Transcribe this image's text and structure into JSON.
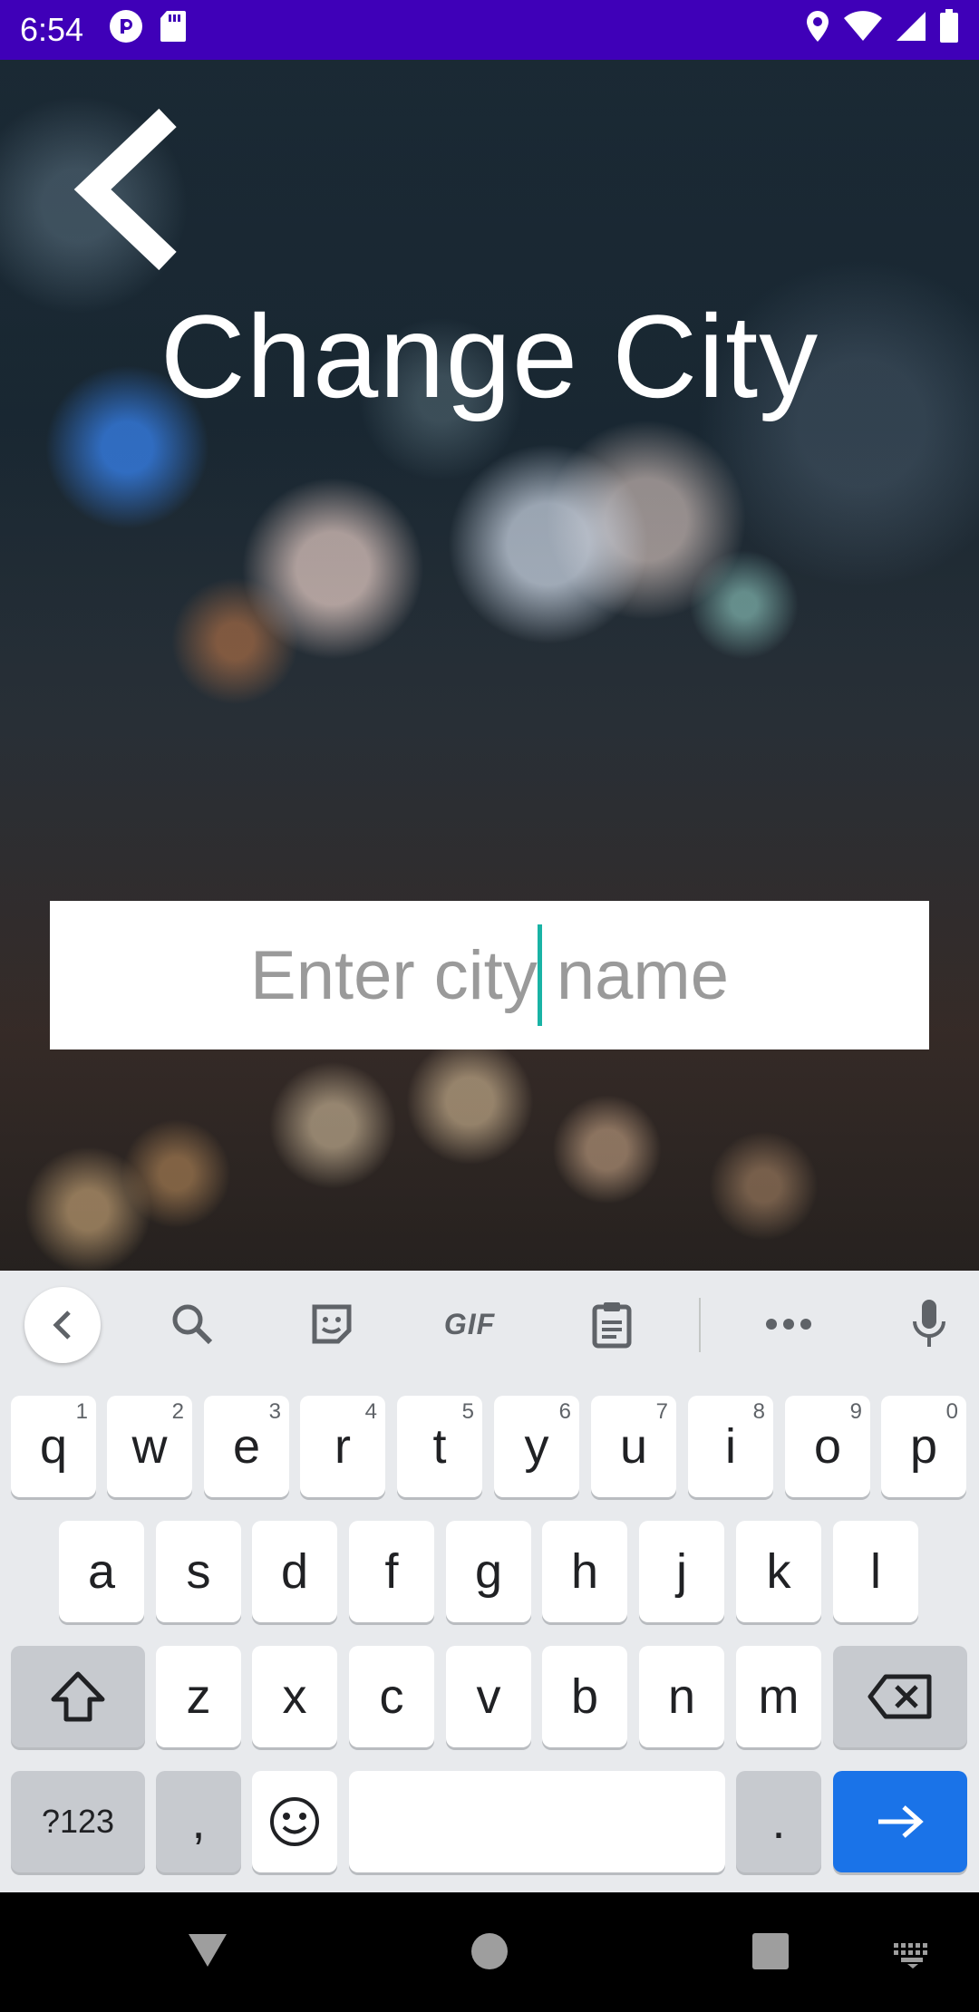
{
  "status_bar": {
    "time": "6:54",
    "left_icons": [
      "pocket-casts-icon",
      "sd-card-icon"
    ],
    "right_icons": [
      "location-icon",
      "wifi-icon",
      "cell-signal-icon",
      "battery-icon"
    ],
    "color": "#3f00b8"
  },
  "page": {
    "title": "Change City",
    "back_icon": "chevron-left-icon"
  },
  "city_input": {
    "placeholder": "Enter city name",
    "value": "",
    "cursor_color": "#19b3a5"
  },
  "keyboard": {
    "toolbar": {
      "items": [
        "collapse-icon",
        "search-icon",
        "sticker-icon",
        "gif-icon",
        "clipboard-icon",
        "more-icon",
        "mic-icon"
      ],
      "gif_label": "GIF"
    },
    "row1": [
      {
        "label": "q",
        "hint": "1"
      },
      {
        "label": "w",
        "hint": "2"
      },
      {
        "label": "e",
        "hint": "3"
      },
      {
        "label": "r",
        "hint": "4"
      },
      {
        "label": "t",
        "hint": "5"
      },
      {
        "label": "y",
        "hint": "6"
      },
      {
        "label": "u",
        "hint": "7"
      },
      {
        "label": "i",
        "hint": "8"
      },
      {
        "label": "o",
        "hint": "9"
      },
      {
        "label": "p",
        "hint": "0"
      }
    ],
    "row2": [
      "a",
      "s",
      "d",
      "f",
      "g",
      "h",
      "j",
      "k",
      "l"
    ],
    "row3": [
      "z",
      "x",
      "c",
      "v",
      "b",
      "n",
      "m"
    ],
    "row4": {
      "symbols_label": "?123",
      "comma_label": ",",
      "period_label": ".",
      "space_label": ""
    },
    "accent_color": "#1a73e8"
  },
  "nav_bar": {
    "items": [
      "back-triangle-icon",
      "home-circle-icon",
      "recents-square-icon",
      "keyboard-switch-icon"
    ]
  }
}
